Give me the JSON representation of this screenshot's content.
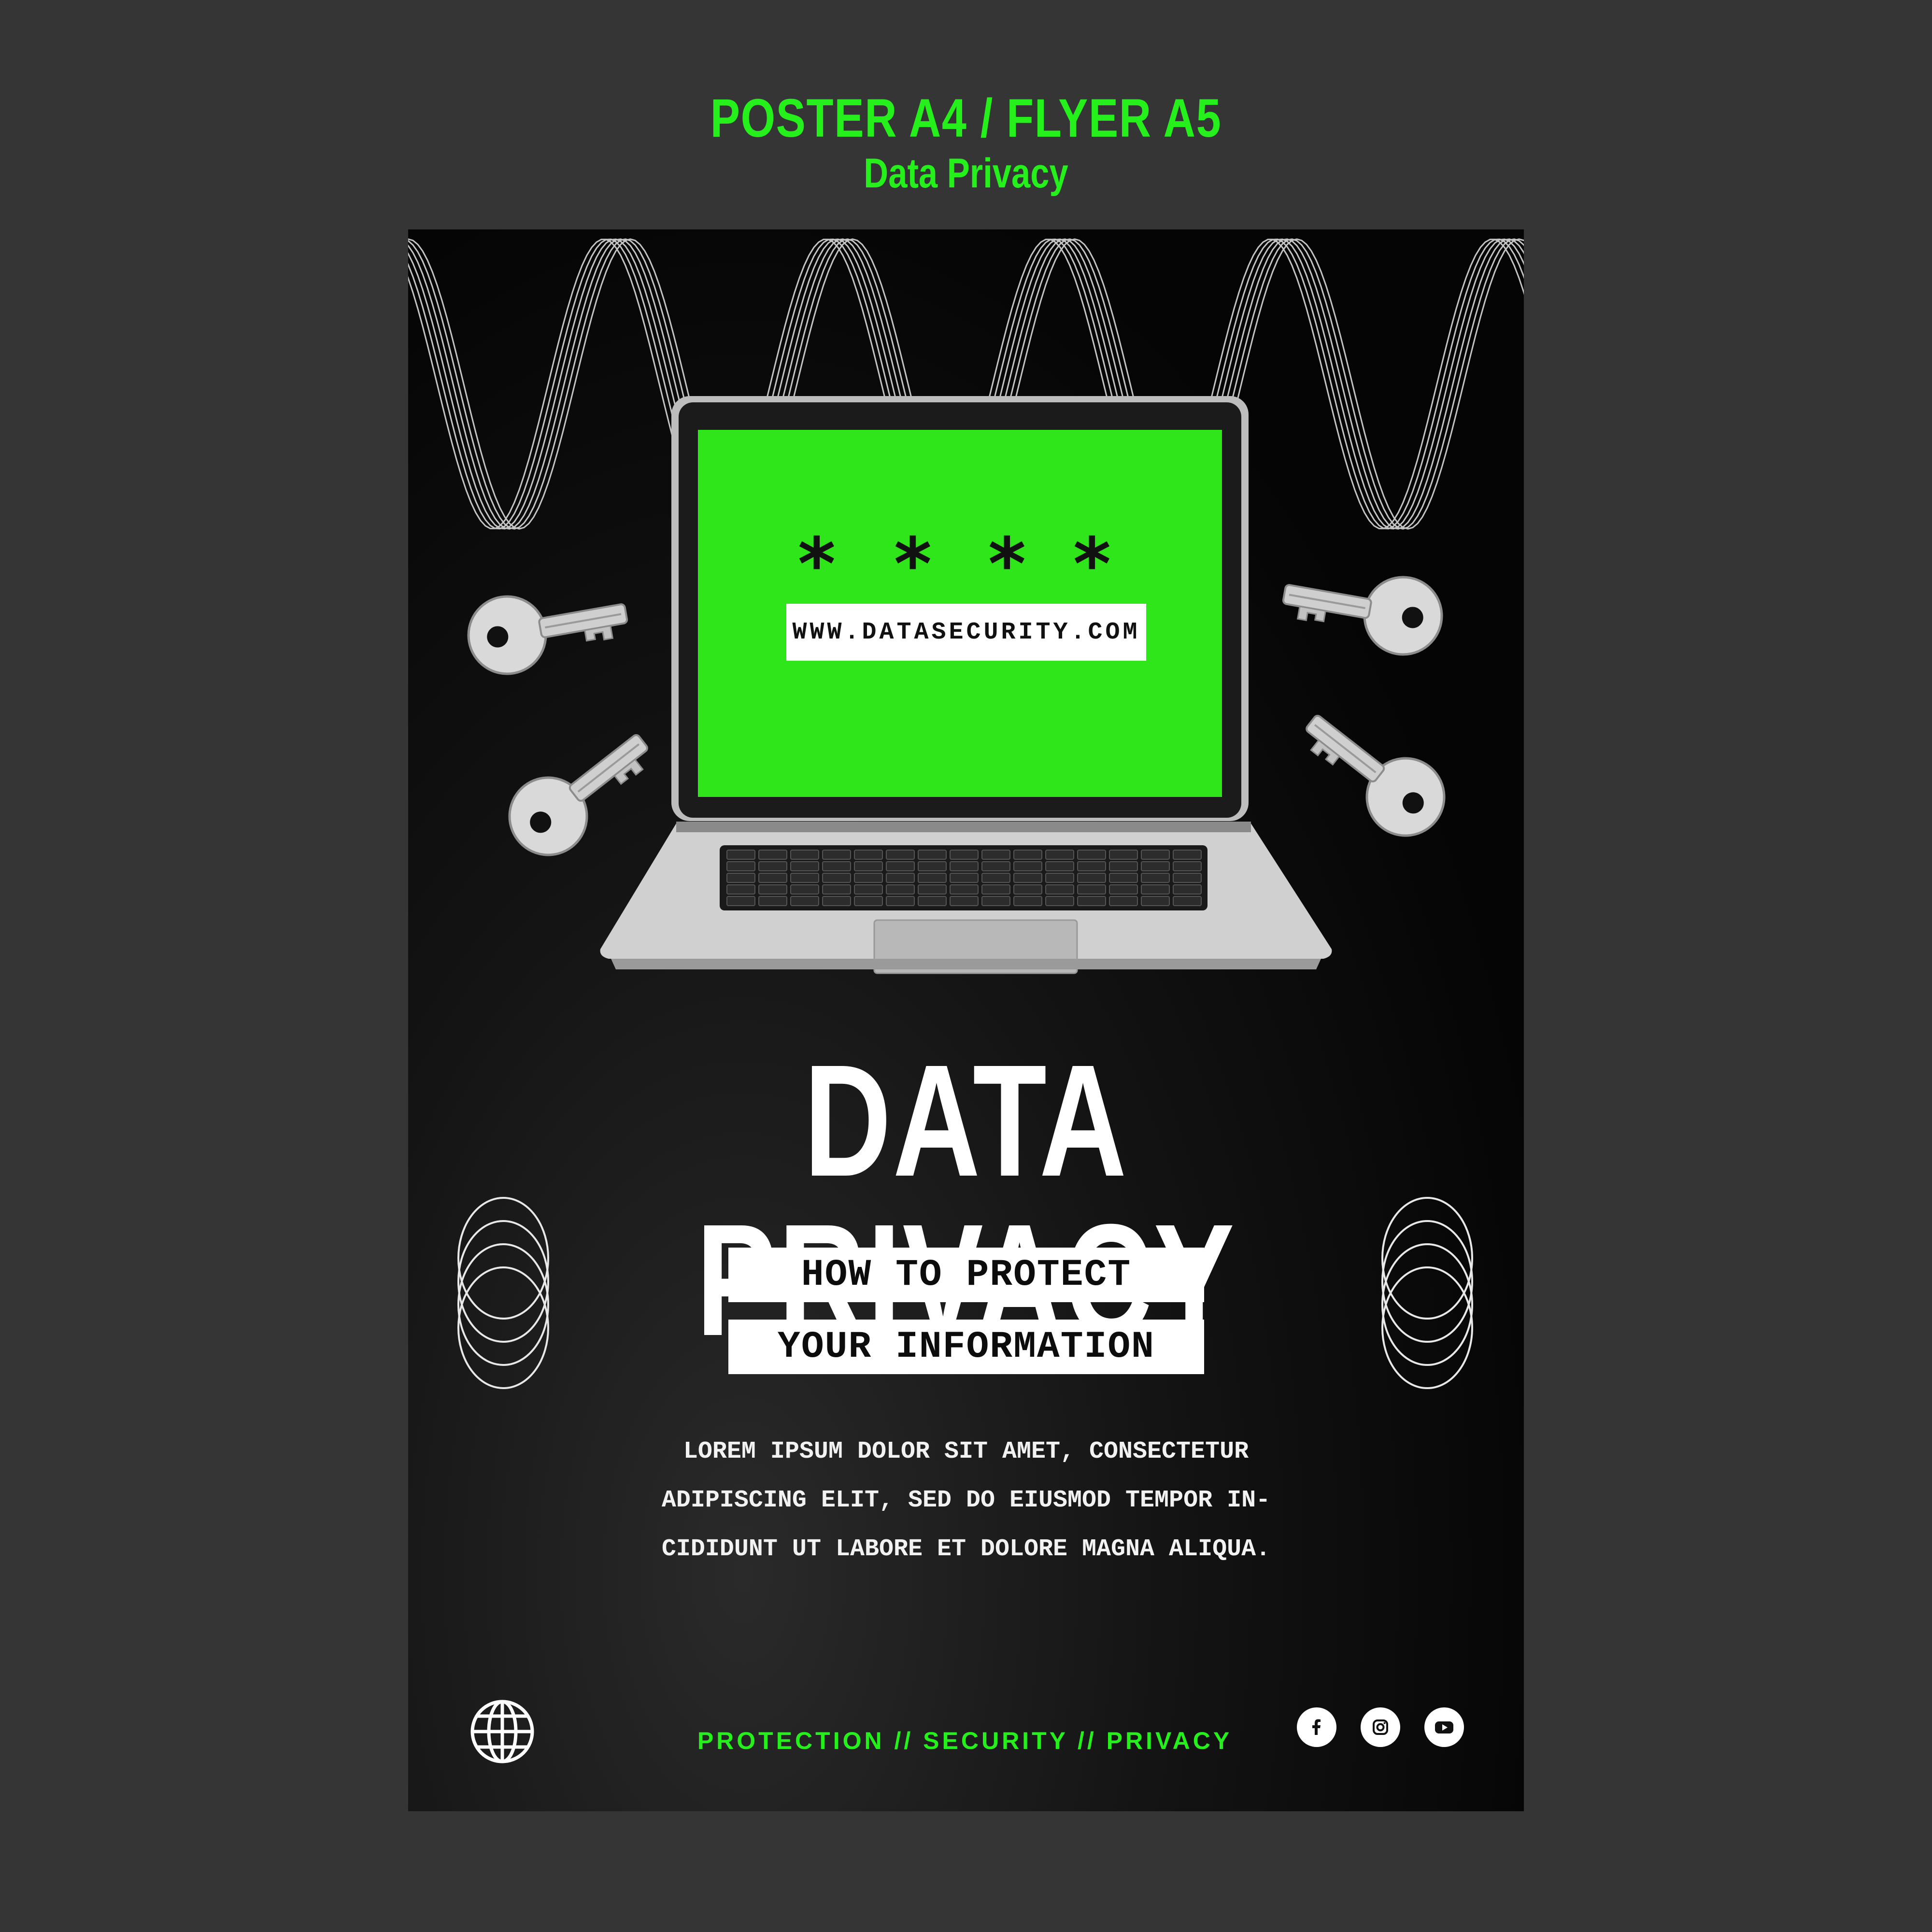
{
  "header": {
    "title": "POSTER A4 / FLYER A5",
    "subtitle": "Data Privacy"
  },
  "poster": {
    "screen": {
      "password_mask": "* * * *",
      "url": "WWW.DATASECURITY.COM"
    },
    "title": "DATA PRIVACY",
    "subtitle_lines": [
      "HOW TO PROTECT",
      "YOUR INFORMATION"
    ],
    "body_lines": [
      "LOREM IPSUM DOLOR SIT AMET, CONSECTETUR",
      "ADIPISCING ELIT, SED DO EIUSMOD TEMPOR IN-",
      "CIDIDUNT UT LABORE ET DOLORE MAGNA ALIQUA."
    ],
    "tagline": "PROTECTION // SECURITY // PRIVACY",
    "icons": [
      "globe-icon",
      "facebook-icon",
      "instagram-icon",
      "youtube-icon",
      "key-icon",
      "laptop-icon"
    ]
  },
  "colors": {
    "background": "#353535",
    "accent_green": "#25f01c",
    "poster_black": "#0a0a0a",
    "white": "#ffffff"
  }
}
